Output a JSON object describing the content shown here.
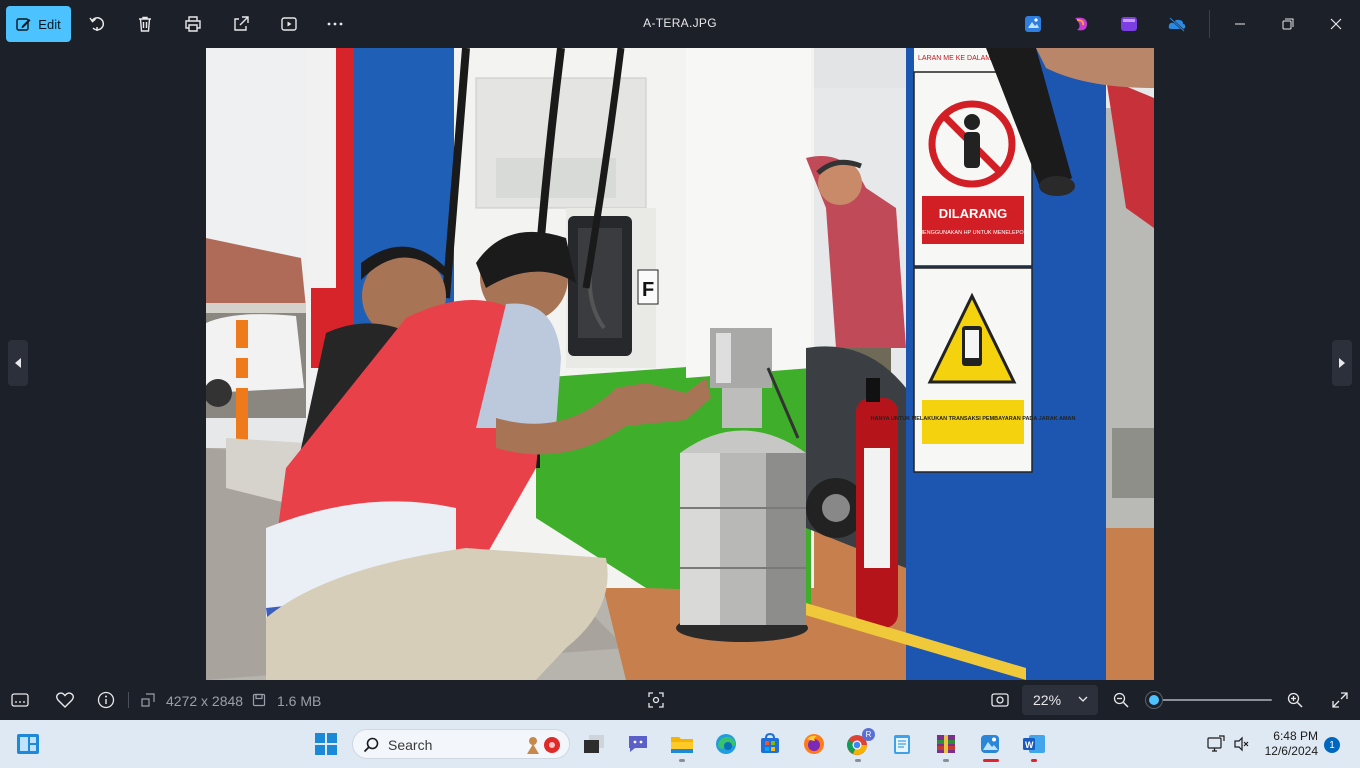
{
  "toolbar": {
    "edit_label": "Edit",
    "icons": [
      "edit-icon",
      "rotate-icon",
      "delete-icon",
      "print-icon",
      "share-icon",
      "slideshow-icon",
      "more-icon"
    ],
    "file_title": "A-TERA.JPG",
    "apps": [
      "photos-editor-icon",
      "clipchamp-icon",
      "designer-icon",
      "onedrive-icon"
    ],
    "window_controls": [
      "minimize-icon",
      "maximize-icon",
      "close-icon"
    ]
  },
  "photo": {
    "sign_top_small": "LARAN ME KE DALAM RUM",
    "sign_dilarang": "DILARANG",
    "sign_dilarang_sub": "MENGGUNAKAN HP UNTUK MENELEPON",
    "sign_bottom": "HANYA UNTUK MELAKUKAN TRANSAKSI PEMBAYARAN PADA JARAK AMAN",
    "pump_letter": "F"
  },
  "infobar": {
    "dimensions": "4272 x 2848",
    "file_size": "1.6 MB",
    "zoom": "22%",
    "zoom_level": 0.05
  },
  "taskbar": {
    "search_placeholder": "Search",
    "time": "6:48 PM",
    "date": "12/6/2024",
    "notification_count": "1",
    "chrome_profile_badge": "R"
  },
  "colors": {
    "accent": "#4cc2ff",
    "background": "#1c2029",
    "taskbar": "#dfe9f3"
  }
}
